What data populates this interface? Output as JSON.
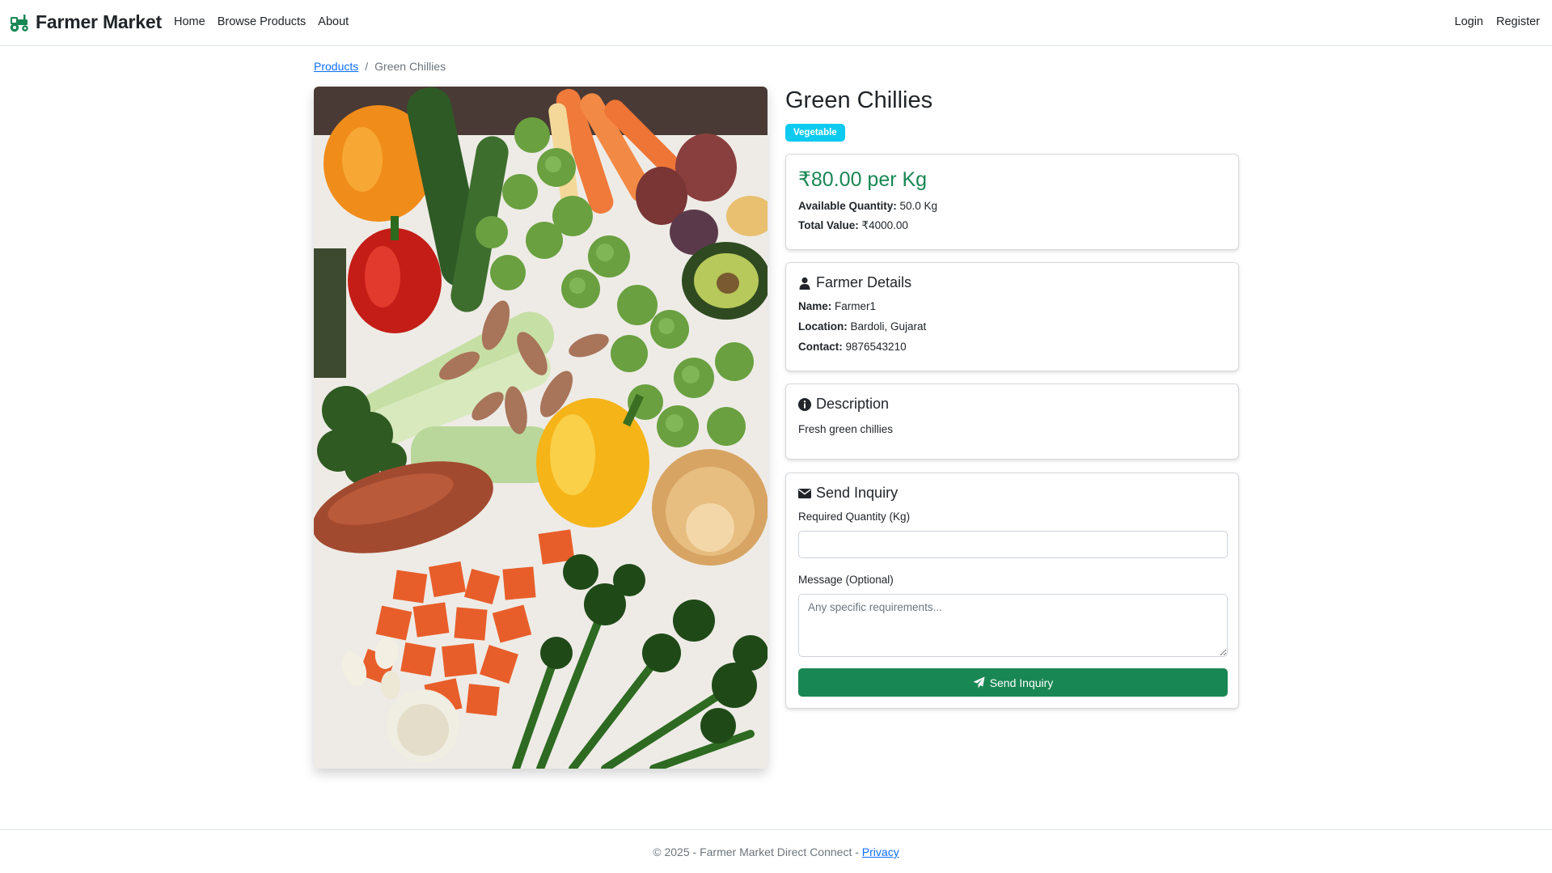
{
  "nav": {
    "brand": "Farmer Market",
    "links": [
      "Home",
      "Browse Products",
      "About"
    ],
    "login": "Login",
    "register": "Register"
  },
  "breadcrumb": {
    "parent": "Products",
    "separator": "/",
    "current": "Green Chillies"
  },
  "product": {
    "name": "Green Chillies",
    "category": "Vegetable",
    "price": "₹80.00 per Kg",
    "available_label": "Available Quantity:",
    "available_value": " 50.0 Kg",
    "total_label": "Total Value:",
    "total_value": " ₹4000.00"
  },
  "farmer": {
    "heading": "Farmer Details",
    "name_label": "Name:",
    "name_value": " Farmer1",
    "location_label": "Location:",
    "location_value": " Bardoli, Gujarat",
    "contact_label": "Contact:",
    "contact_value": " 9876543210"
  },
  "description": {
    "heading": "Description",
    "text": "Fresh green chillies"
  },
  "inquiry": {
    "heading": "Send Inquiry",
    "quantity_label": "Required Quantity (Kg)",
    "quantity_value": "",
    "message_label": "Message (Optional)",
    "message_placeholder": "Any specific requirements...",
    "button_label": "Send Inquiry"
  },
  "footer": {
    "text": "© 2025 - Farmer Market Direct Connect - ",
    "privacy": "Privacy"
  },
  "colors": {
    "brand_green": "#198754",
    "badge_cyan": "#0dcaf0",
    "link_blue": "#0d6efd"
  },
  "icons": {
    "brand": "tractor-icon",
    "farmer": "user-icon",
    "description": "info-circle-icon",
    "inquiry": "envelope-icon",
    "send": "paper-plane-icon"
  }
}
